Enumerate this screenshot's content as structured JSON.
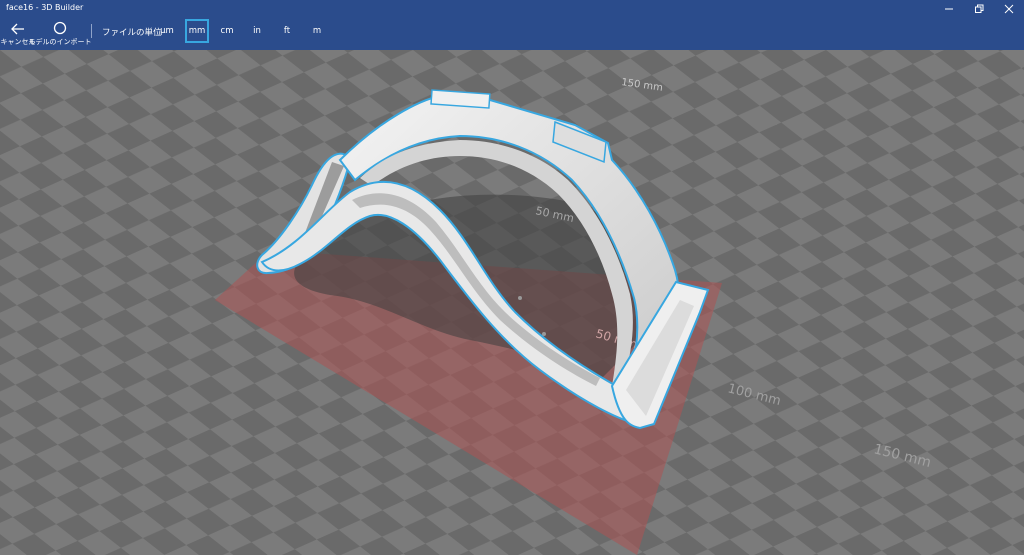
{
  "window": {
    "title": "face16 - 3D Builder"
  },
  "toolbar": {
    "cancel_label": "キャンセル",
    "import_label": "モデルのインポート",
    "units_label": "ファイルの単位",
    "units": [
      {
        "label": "µm",
        "selected": false
      },
      {
        "label": "mm",
        "selected": true
      },
      {
        "label": "cm",
        "selected": false
      },
      {
        "label": "in",
        "selected": false
      },
      {
        "label": "ft",
        "selected": false
      },
      {
        "label": "m",
        "selected": false
      }
    ]
  },
  "scene": {
    "rulers": [
      "150 mm",
      "50 mm",
      "50 mm",
      "100 mm",
      "150 mm"
    ],
    "colors": {
      "background": "#6d6d6d",
      "grid_light": "#7a7a7a",
      "grid_dark": "#626262",
      "footprint": "#a95454",
      "selection": "#38a7e0",
      "model": "#e6e6e6",
      "titlebar": "#2b4c8c"
    }
  }
}
